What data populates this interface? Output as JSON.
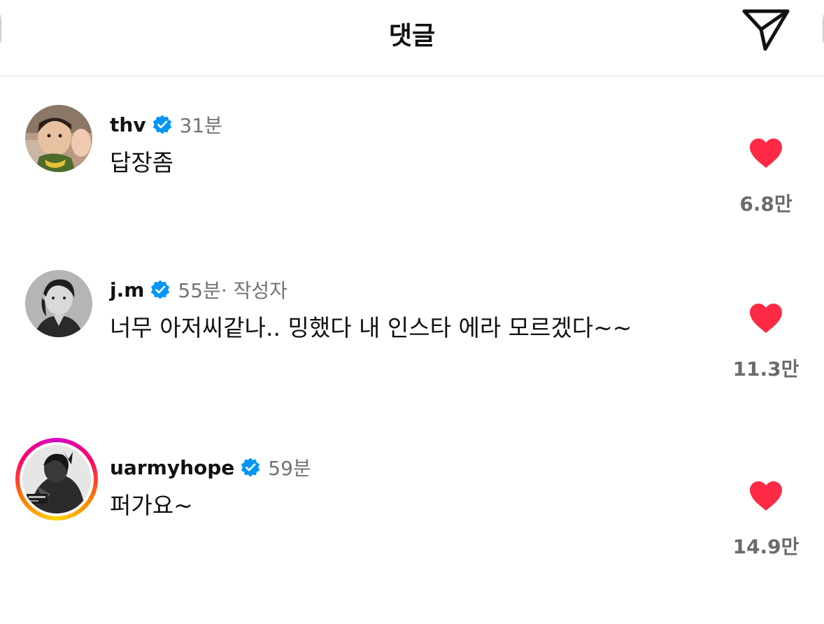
{
  "header": {
    "title": "댓글",
    "share_icon": "paper-plane-icon"
  },
  "colors": {
    "like": "#fe2944",
    "verified": "#0095f6",
    "story_ring": [
      "#d300c5",
      "#ff0069",
      "#ff7a00",
      "#ffd600"
    ]
  },
  "comments": [
    {
      "username": "thv",
      "time": "31분",
      "author_tag": "",
      "text": "답장좀",
      "likes": "6.8만",
      "story_ring": false
    },
    {
      "username": "j.m",
      "time": "55분",
      "author_tag": " · 작성자",
      "text": "너무 아저씨같나.. 밍했다 내 인스타 에라 모르겠다~~",
      "likes": "11.3만",
      "story_ring": false
    },
    {
      "username": "uarmyhope",
      "time": "59분",
      "author_tag": "",
      "text": "퍼가요~",
      "likes": "14.9만",
      "story_ring": true
    }
  ]
}
